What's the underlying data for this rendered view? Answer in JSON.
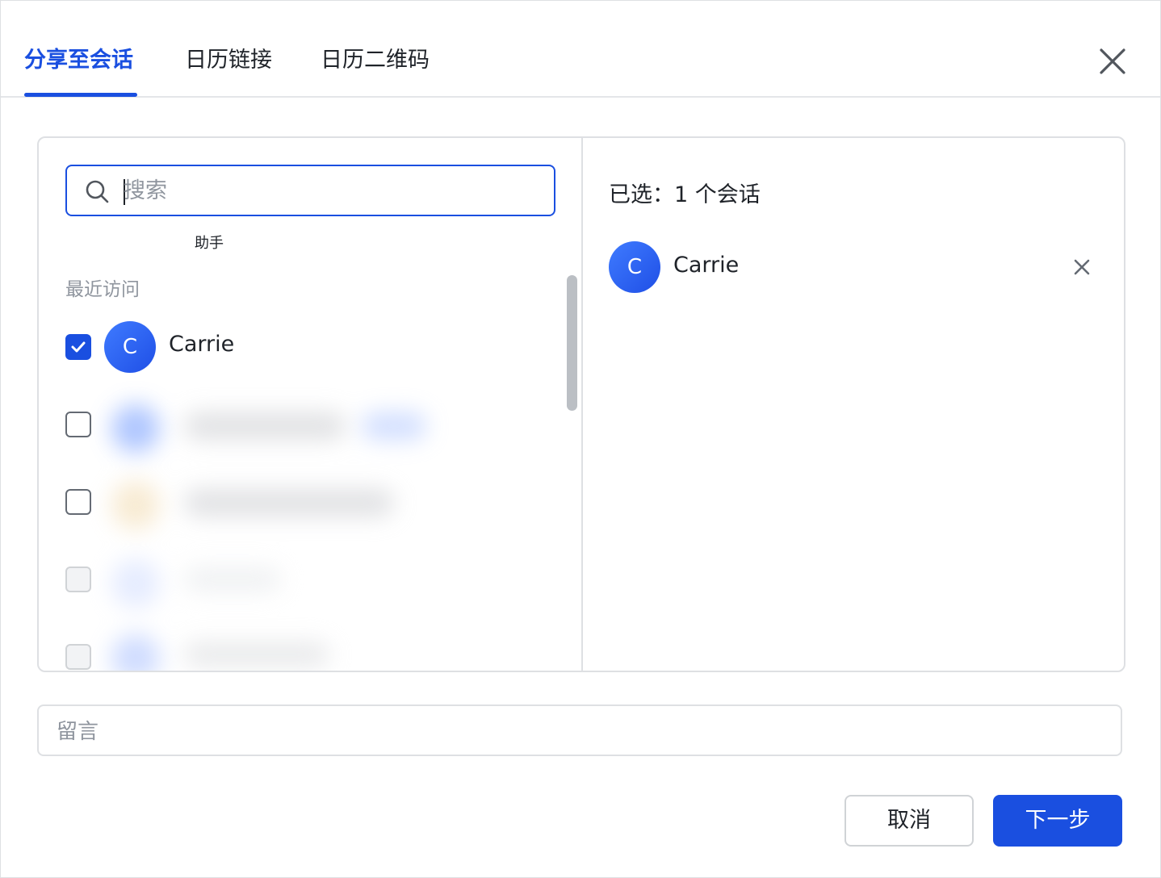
{
  "tabs": [
    {
      "label": "分享至会话",
      "active": true
    },
    {
      "label": "日历链接",
      "active": false
    },
    {
      "label": "日历二维码",
      "active": false
    }
  ],
  "search": {
    "placeholder": "搜索",
    "value": ""
  },
  "left": {
    "assistant_label": "助手",
    "section_label": "最近访问",
    "contacts": [
      {
        "initial": "C",
        "name": "Carrie",
        "checked": true
      }
    ]
  },
  "right": {
    "selected_count": "已选：1 个会话",
    "selected": [
      {
        "initial": "C",
        "name": "Carrie"
      }
    ]
  },
  "message": {
    "placeholder": "留言",
    "value": ""
  },
  "buttons": {
    "cancel": "取消",
    "next": "下一步"
  },
  "colors": {
    "accent": "#1a4fe0",
    "border": "#dee0e3",
    "muted": "#8f959e"
  },
  "icons": [
    "close-icon",
    "search-icon",
    "check-icon",
    "remove-icon"
  ]
}
